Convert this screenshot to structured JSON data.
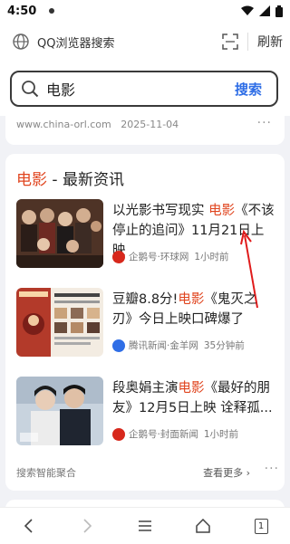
{
  "status_bar": {
    "time": "4:50"
  },
  "browser_bar": {
    "title": "QQ浏览器搜索",
    "refresh_label": "刷新"
  },
  "search": {
    "query": "电影",
    "button_label": "搜索"
  },
  "previous_result": {
    "source": "www.china-orl.com",
    "date": "2025-11-04",
    "more": "···"
  },
  "news_card": {
    "heading_highlight": "电影",
    "heading_rest": " - 最新资讯",
    "items": [
      {
        "title_pre": "以光影书写现实 ",
        "title_hl": "电影",
        "title_post": "《不该停止的追问》11月21日上映",
        "source": "企鹅号·环球网",
        "time": "1小时前",
        "source_icon_color": "#d7281c"
      },
      {
        "title_pre": "豆瓣8.8分!",
        "title_hl": "电影",
        "title_post": "《鬼灭之刃》今日上映口碑爆了",
        "source": "腾讯新闻·金羊网",
        "time": "35分钟前",
        "source_icon_color": "#2f6ee6"
      },
      {
        "title_pre": "段奥娟主演",
        "title_hl": "电影",
        "title_post": "《最好的朋友》12月5日上映 诠释孤...",
        "source": "企鹅号·封面新闻",
        "time": "1小时前",
        "source_icon_color": "#d7281c"
      }
    ],
    "aggregation_label": "搜索智能聚合",
    "view_more_label": "查看更多 ›",
    "more_dots": "···"
  },
  "colors": {
    "accent": "#2f6ee6",
    "highlight": "#e0451f",
    "annotation_arrow": "#e01b1b"
  },
  "icons": {
    "status": [
      "wifi-icon",
      "signal-icon",
      "battery-icon"
    ],
    "browser": [
      "globe-icon",
      "scan-icon"
    ],
    "search": "search-icon",
    "nav": [
      "back-icon",
      "forward-icon",
      "menu-icon",
      "home-icon",
      "tabs-icon"
    ]
  },
  "nav": {
    "tab_count": "1"
  }
}
